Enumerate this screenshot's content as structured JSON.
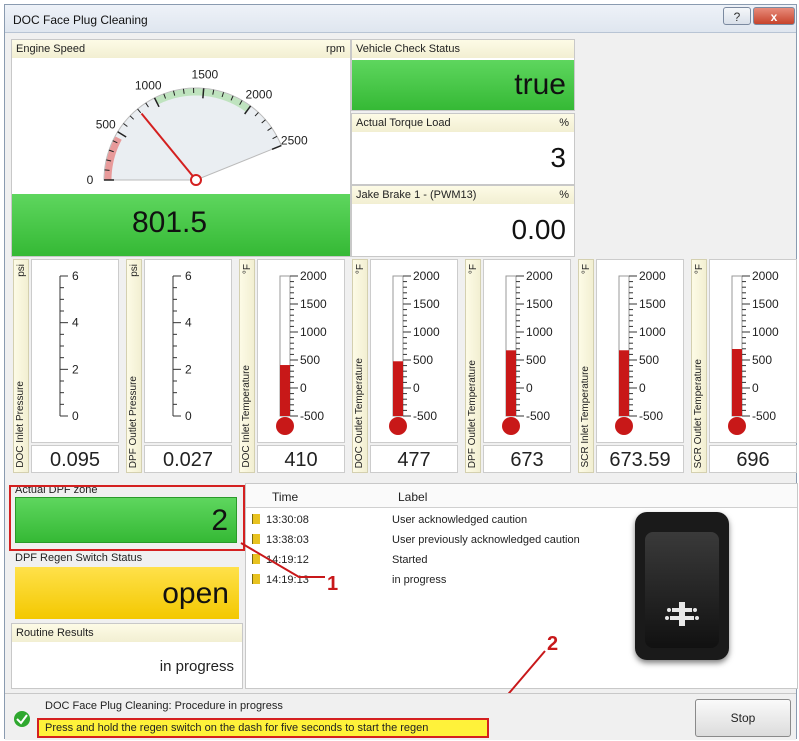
{
  "window": {
    "title": "DOC Face Plug Cleaning",
    "help_label": "?",
    "close_label": "x"
  },
  "engine_speed": {
    "label": "Engine Speed",
    "unit": "rpm",
    "value": "801.5",
    "gauge": {
      "min": 0,
      "max": 2500,
      "needle_value": 801.5,
      "ticks": [
        "0",
        "500",
        "1000",
        "1500",
        "2000",
        "2500"
      ]
    }
  },
  "vehicle_check": {
    "label": "Vehicle Check Status",
    "value": "true"
  },
  "torque_load": {
    "label": "Actual Torque Load",
    "unit": "%",
    "value": "3"
  },
  "jake_brake": {
    "label": "Jake Brake 1 - (PWM13)",
    "unit": "%",
    "value": "0.00"
  },
  "gauges": [
    {
      "label": "DOC Inlet Pressure",
      "unit": "psi",
      "value": "0.095",
      "ticks": [
        "6",
        "4",
        "2",
        "0"
      ]
    },
    {
      "label": "DPF Outlet Pressure",
      "unit": "psi",
      "value": "0.027",
      "ticks": [
        "6",
        "4",
        "2",
        "0"
      ]
    },
    {
      "label": "DOC Inlet Temperature",
      "unit": "°F",
      "value": "410",
      "ticks": [
        "2000",
        "1500",
        "1000",
        "500",
        "0",
        "-500"
      ]
    },
    {
      "label": "DOC Outlet Temperature",
      "unit": "°F",
      "value": "477",
      "ticks": [
        "2000",
        "1500",
        "1000",
        "500",
        "0",
        "-500"
      ]
    },
    {
      "label": "DPF Outlet Temperature",
      "unit": "°F",
      "value": "673",
      "ticks": [
        "2000",
        "1500",
        "1000",
        "500",
        "0",
        "-500"
      ]
    },
    {
      "label": "SCR Inlet Temperature",
      "unit": "°F",
      "value": "673.59",
      "ticks": [
        "2000",
        "1500",
        "1000",
        "500",
        "0",
        "-500"
      ]
    },
    {
      "label": "SCR Outlet Temperature",
      "unit": "°F",
      "value": "696",
      "ticks": [
        "2000",
        "1500",
        "1000",
        "500",
        "0",
        "-500"
      ]
    }
  ],
  "dpf_zone": {
    "label": "Actual DPF zone",
    "value": "2"
  },
  "regen_switch": {
    "label": "DPF Regen Switch Status",
    "value": "open"
  },
  "routine_results": {
    "label": "Routine Results",
    "value": "in progress"
  },
  "events": {
    "col_time": "Time",
    "col_label": "Label",
    "rows": [
      {
        "time": "13:30:08",
        "label": "User acknowledged caution"
      },
      {
        "time": "13:38:03",
        "label": "User previously acknowledged caution"
      },
      {
        "time": "14:19:12",
        "label": "Started"
      },
      {
        "time": "14:19:13",
        "label": "in progress"
      }
    ]
  },
  "status": {
    "line1": "DOC Face Plug Cleaning: Procedure in progress",
    "line2": "Press and hold the regen switch on the dash for five seconds to start the regen"
  },
  "stop_label": "Stop",
  "callouts": {
    "one": "1",
    "two": "2"
  },
  "colors": {
    "green": "#3cc43c",
    "yellow": "#ffd700",
    "red": "#d42020"
  }
}
